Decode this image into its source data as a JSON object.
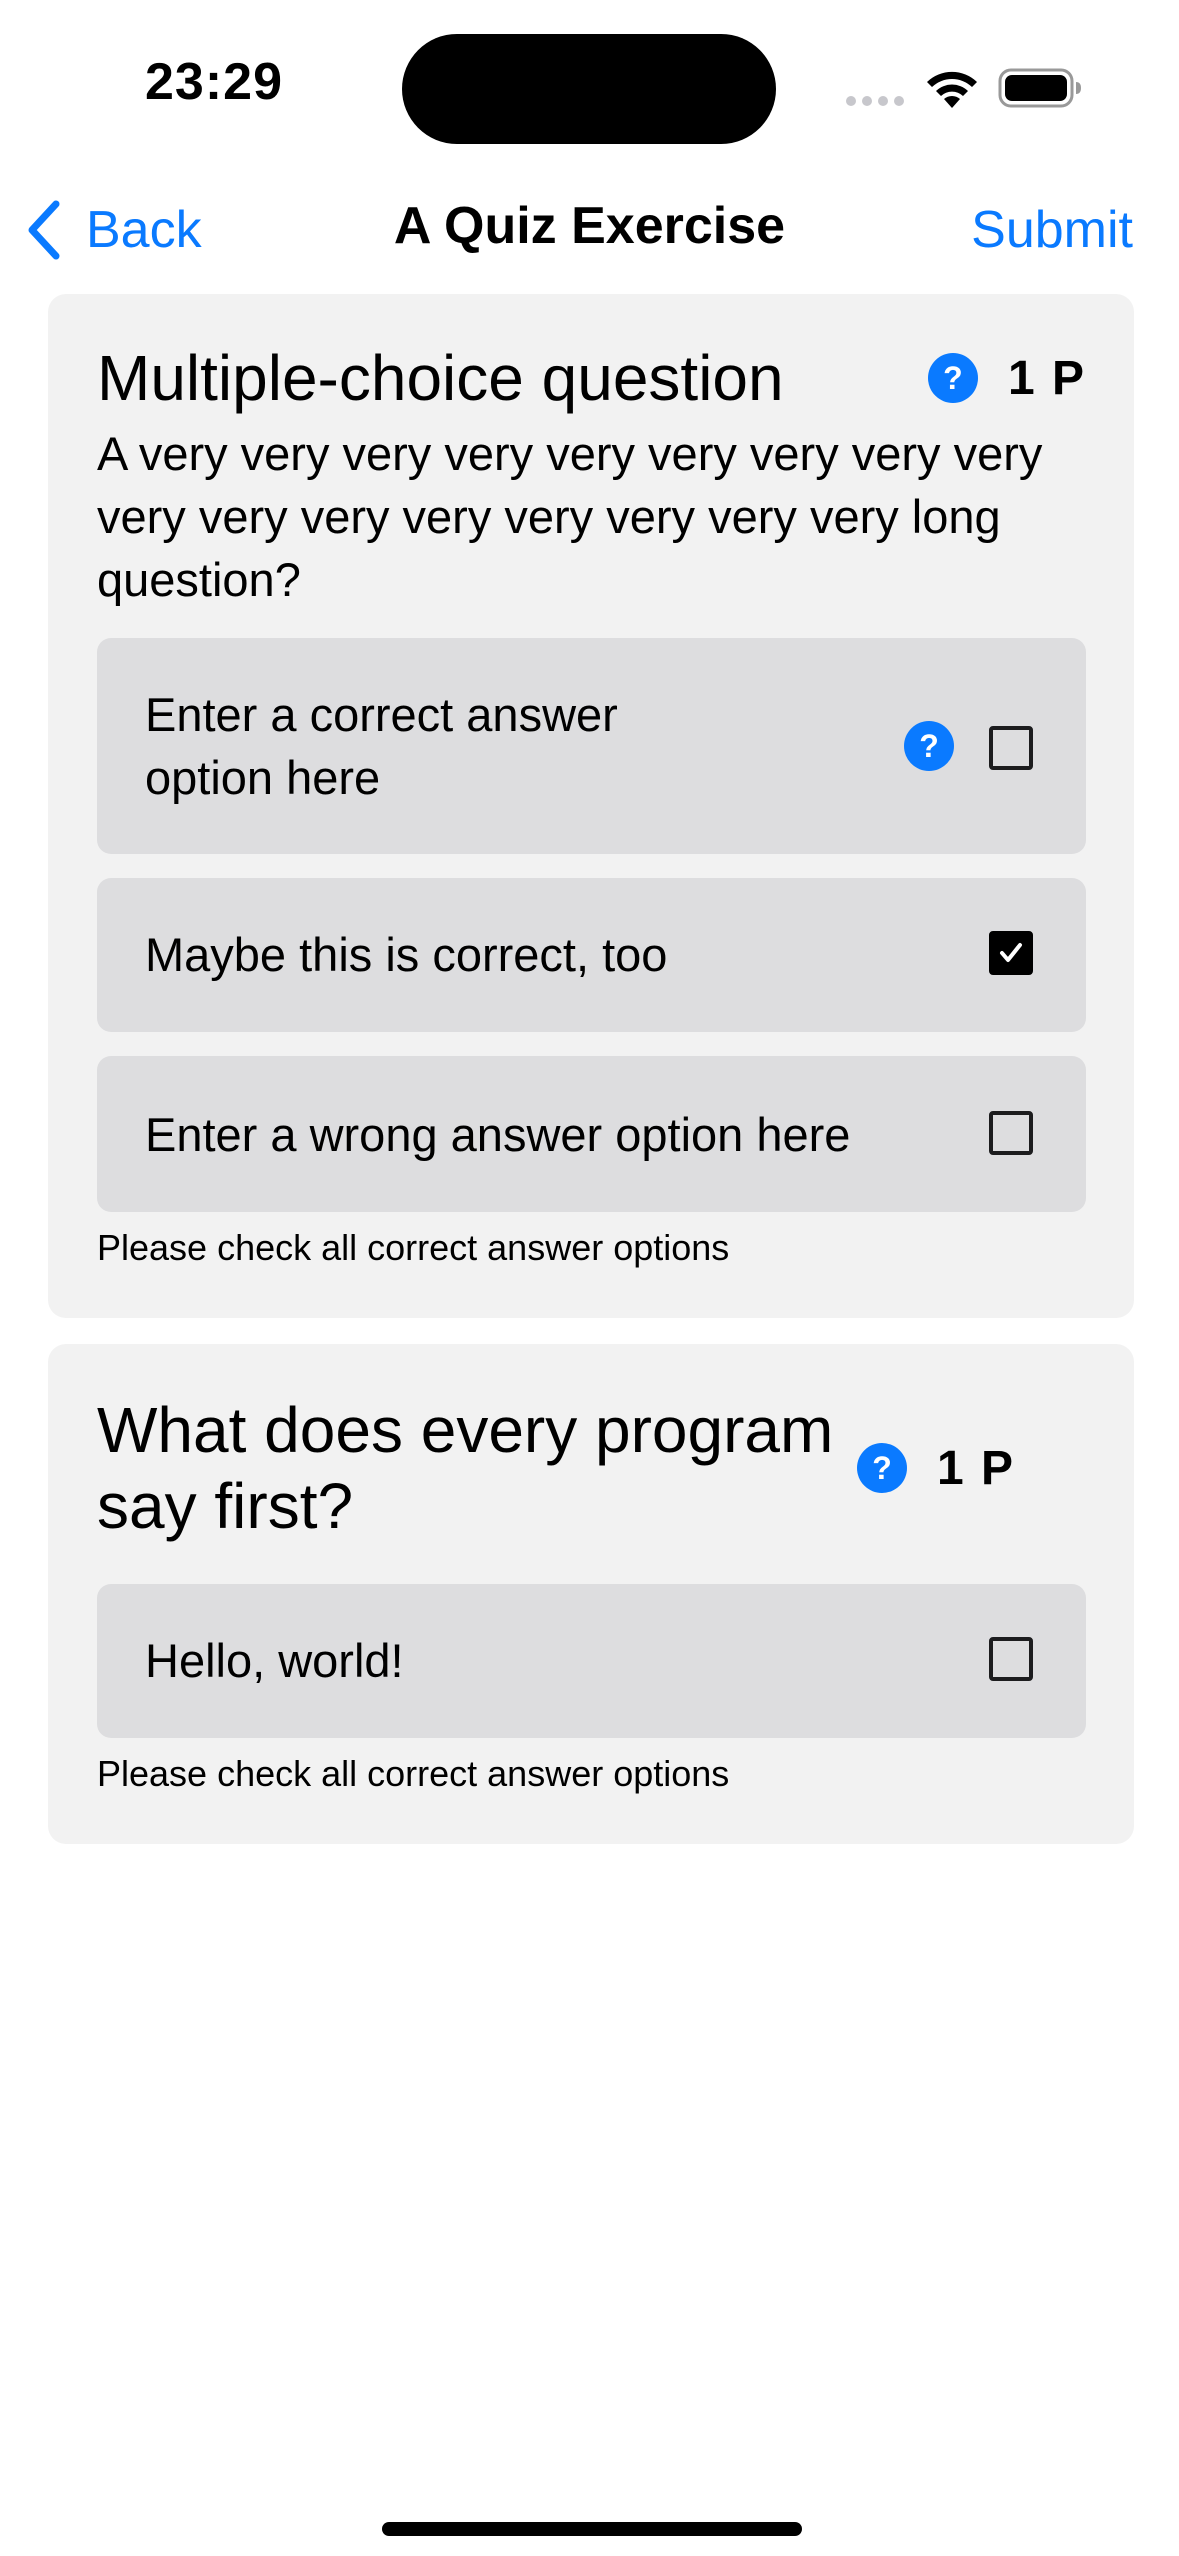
{
  "status_bar": {
    "time": "23:29"
  },
  "nav": {
    "back_label": "Back",
    "title": "A Quiz Exercise",
    "submit_label": "Submit"
  },
  "accent_color": "#0a7aff",
  "questions": [
    {
      "title": "Multiple-choice question",
      "points": "1 P",
      "help_icon": "?",
      "text": "A very very very very very very very very very very very very very very very very very long question?",
      "options": [
        {
          "text": "Enter a correct answer option here",
          "has_hint": true,
          "hint_icon": "?",
          "checked": false
        },
        {
          "text": "Maybe this is correct, too",
          "has_hint": false,
          "checked": true
        },
        {
          "text": "Enter a wrong answer option here",
          "has_hint": false,
          "checked": false
        }
      ],
      "instruction": "Please check all correct answer options"
    },
    {
      "title": "What does every program say first?",
      "points": "1 P",
      "help_icon": "?",
      "options": [
        {
          "text": "Hello, world!",
          "has_hint": false,
          "checked": false
        }
      ],
      "instruction": "Please check all correct answer options"
    }
  ]
}
